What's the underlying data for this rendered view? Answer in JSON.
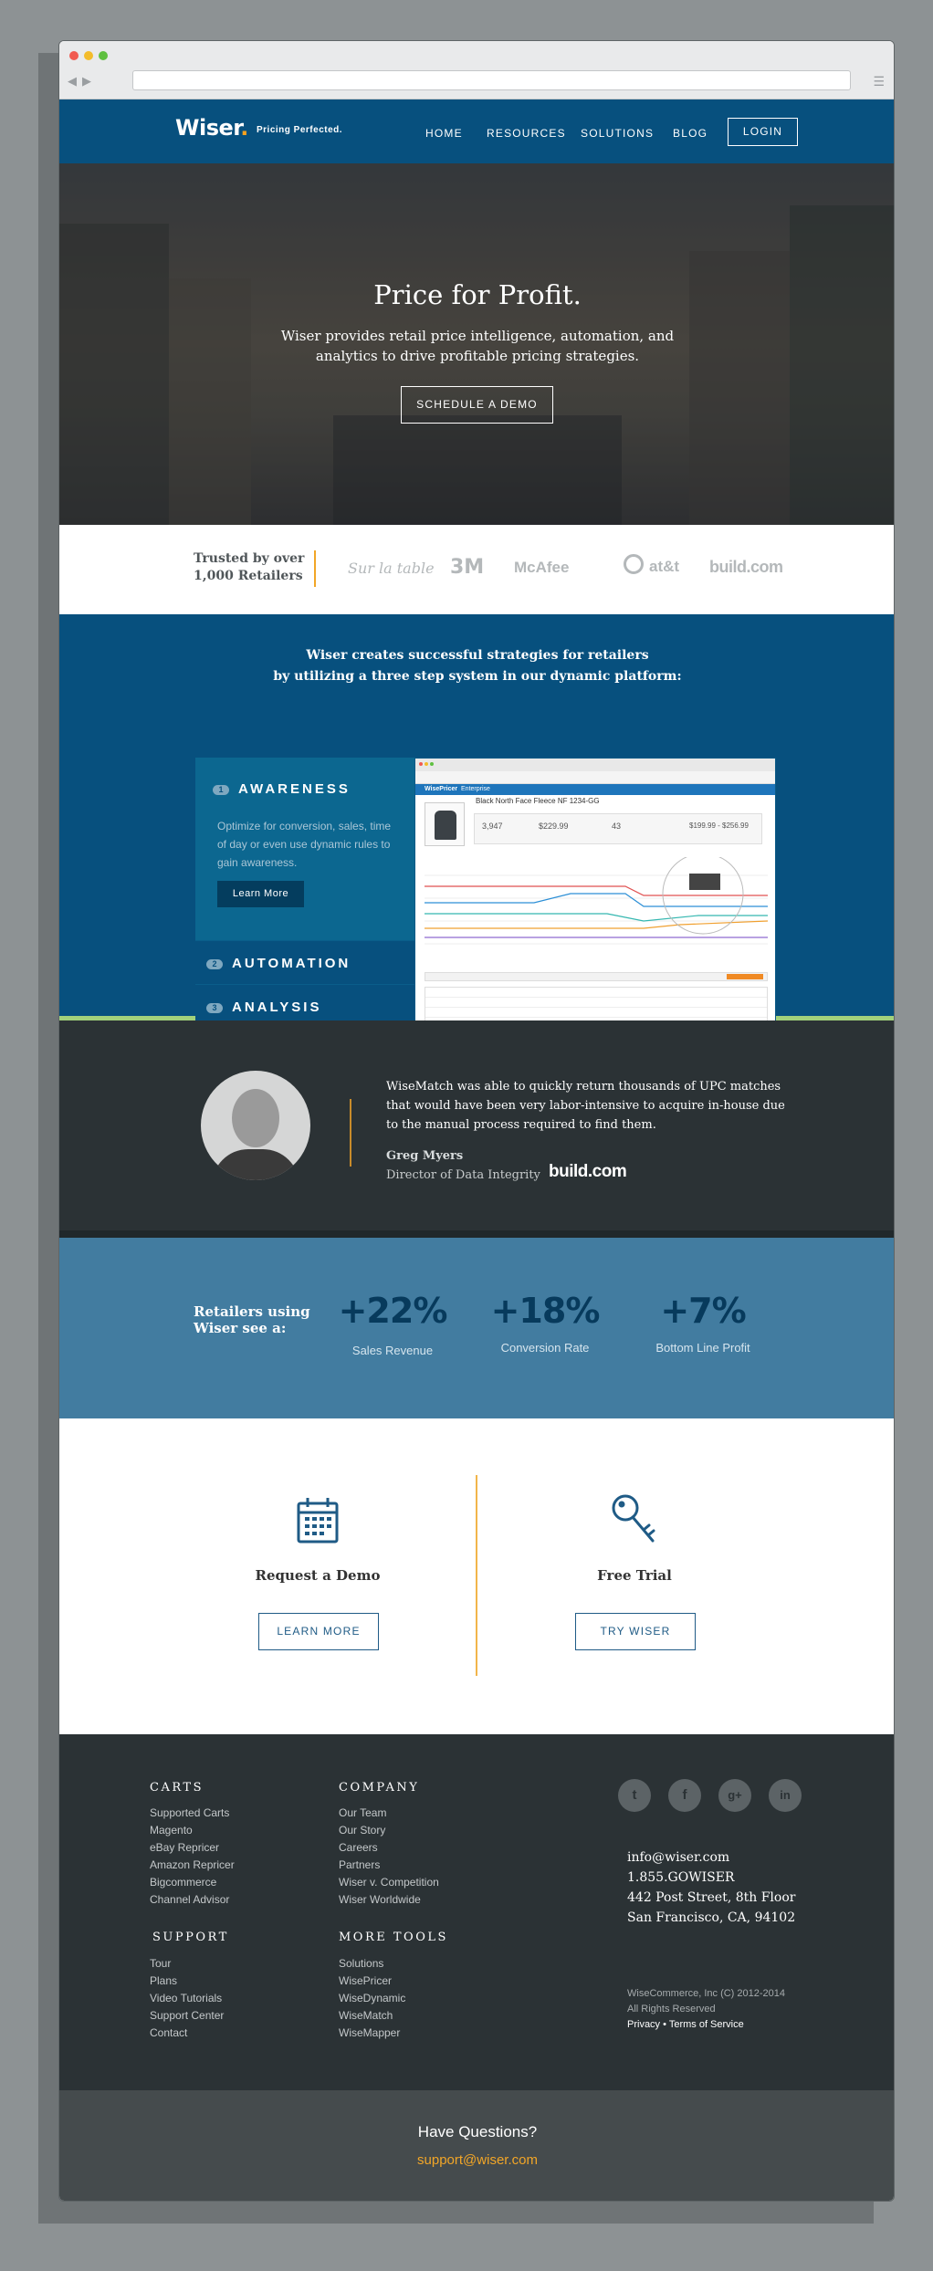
{
  "header": {
    "logo": "Wiser",
    "tagline": "Pricing Perfected.",
    "nav": [
      "HOME",
      "RESOURCES",
      "SOLUTIONS",
      "BLOG"
    ],
    "login": "LOGIN"
  },
  "hero": {
    "title": "Price for Profit.",
    "subtitle_line1": "Wiser provides retail price intelligence, automation, and",
    "subtitle_line2": "analytics to drive profitable pricing strategies.",
    "cta": "SCHEDULE A DEMO"
  },
  "trusted": {
    "line1": "Trusted by over",
    "line2": "1,000 Retailers",
    "brands": [
      "Sur la table",
      "3M",
      "McAfee",
      "at&t",
      "build.com"
    ]
  },
  "platform": {
    "heading_line1": "Wiser creates successful strategies for retailers",
    "heading_line2": "by utilizing a three step system in our dynamic platform:",
    "steps": [
      {
        "num": "1",
        "label": "AWARENESS"
      },
      {
        "num": "2",
        "label": "AUTOMATION"
      },
      {
        "num": "3",
        "label": "ANALYSIS"
      }
    ],
    "awareness_desc": "Optimize for conversion, sales, time of day or even use dynamic rules to gain awareness.",
    "learn_more": "Learn More",
    "screenshot": {
      "app": "WisePricer",
      "edition": "Enterprise",
      "product": "Black North Face Fleece NF 1234-GG",
      "price": "$229.99",
      "metric1": "3,947",
      "metric2": "43",
      "price_range": "$199.99 - $256.99"
    }
  },
  "testimonial": {
    "quote": "WiseMatch was able to quickly return thousands of UPC matches that would have been very labor-intensive to acquire in-house due to the manual process required to find them.",
    "name": "Greg Myers",
    "role": "Director of Data Integrity",
    "logo": "build.com"
  },
  "stats": {
    "label_line1": "Retailers using",
    "label_line2": "Wiser see a:",
    "items": [
      {
        "value": "+22%",
        "label": "Sales Revenue"
      },
      {
        "value": "+18%",
        "label": "Conversion Rate"
      },
      {
        "value": "+7%",
        "label": "Bottom Line Profit"
      }
    ]
  },
  "cta": {
    "demo_title": "Request a Demo",
    "demo_button": "LEARN MORE",
    "trial_title": "Free Trial",
    "trial_button": "TRY WISER"
  },
  "footer": {
    "carts_heading": "CARTS",
    "carts": [
      "Supported Carts",
      "Magento",
      "eBay Repricer",
      "Amazon Repricer",
      "Bigcommerce",
      "Channel Advisor"
    ],
    "company_heading": "COMPANY",
    "company": [
      "Our Team",
      "Our Story",
      "Careers",
      "Partners",
      "Wiser v. Competition",
      "Wiser Worldwide"
    ],
    "support_heading": "SUPPORT",
    "support": [
      "Tour",
      "Plans",
      "Video Tutorials",
      "Support Center",
      "Contact"
    ],
    "tools_heading": "MORE TOOLS",
    "tools": [
      "Solutions",
      "WisePricer",
      "WiseDynamic",
      "WiseMatch",
      "WiseMapper"
    ],
    "email": "info@wiser.com",
    "phone": "1.855.GOWISER",
    "address1": "442 Post Street, 8th Floor",
    "address2": "San Francisco, CA, 94102",
    "copyright1": "WiseCommerce, Inc (C) 2012-2014",
    "copyright2": "All Rights Reserved",
    "privacy": "Privacy",
    "terms": "Terms of Service"
  },
  "questions": {
    "heading": "Have Questions?",
    "email": "support@wiser.com"
  }
}
